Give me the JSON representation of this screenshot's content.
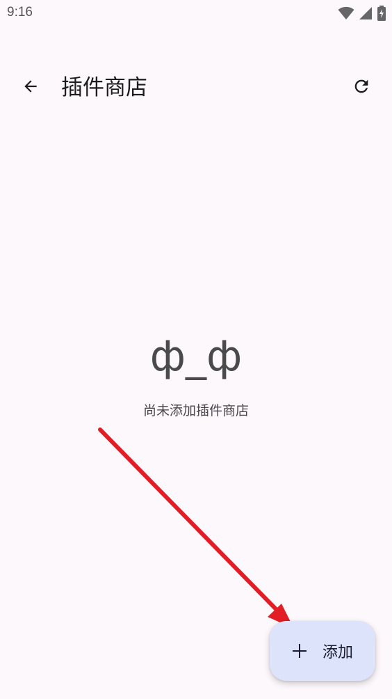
{
  "status_bar": {
    "time": "9:16",
    "icons": [
      "wifi-icon",
      "cell-signal-icon",
      "battery-charging-icon"
    ]
  },
  "app_bar": {
    "back_icon": "arrow-back-icon",
    "title": "插件商店",
    "refresh_icon": "refresh-icon"
  },
  "empty_state": {
    "face": "ф_ф",
    "message": "尚未添加插件商店"
  },
  "fab": {
    "icon": "plus-icon",
    "label": "添加"
  },
  "colors": {
    "background": "#fdf8fc",
    "fab_background": "#dde3fa",
    "annotation_arrow": "#e31d25"
  }
}
